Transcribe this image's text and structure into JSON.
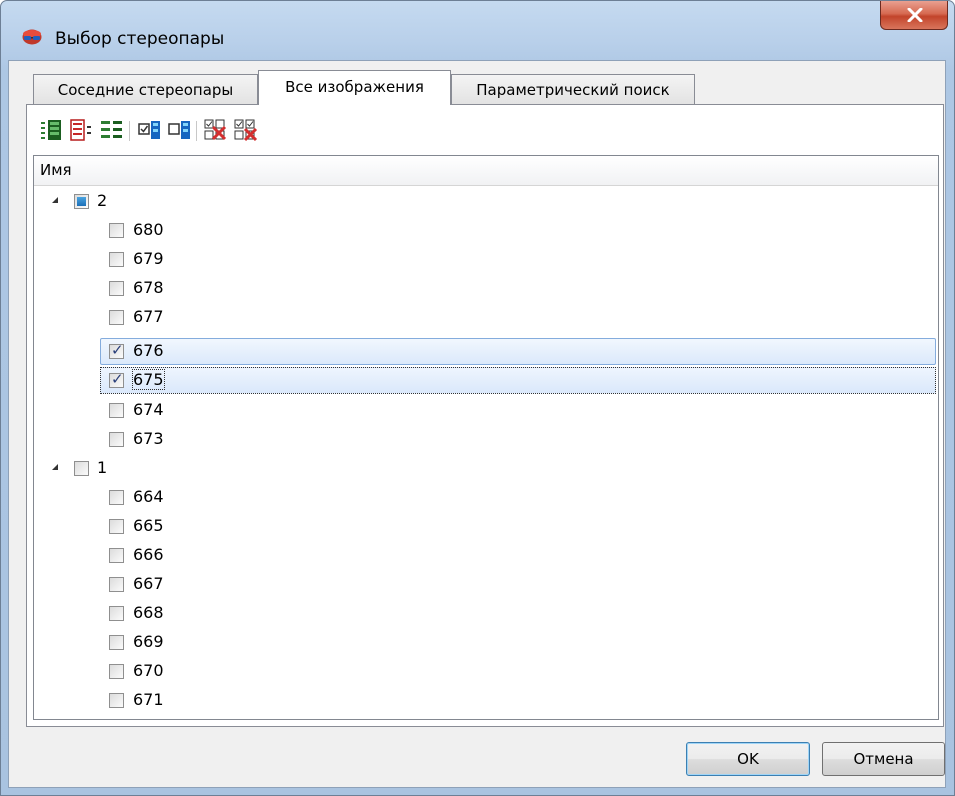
{
  "window": {
    "title": "Выбор стереопары",
    "app_icon": "stereo-glasses-icon",
    "close_icon": "close-icon"
  },
  "tabs": [
    {
      "label": "Соседние стереопары",
      "active": false
    },
    {
      "label": "Все изображения",
      "active": true
    },
    {
      "label": "Параметрический поиск",
      "active": false
    }
  ],
  "toolbar": [
    {
      "icon": "expand-all-icon"
    },
    {
      "icon": "collapse-all-icon"
    },
    {
      "icon": "expand-selected-icon"
    },
    {
      "icon": "check-all-icon"
    },
    {
      "icon": "uncheck-all-icon"
    },
    {
      "icon": "remove-checked-icon"
    },
    {
      "icon": "remove-all-icon"
    }
  ],
  "tree": {
    "column_header": "Имя",
    "groups": [
      {
        "label": "2",
        "state": "partial",
        "items": [
          {
            "label": "680",
            "checked": false
          },
          {
            "label": "679",
            "checked": false
          },
          {
            "label": "678",
            "checked": false
          },
          {
            "label": "677",
            "checked": false
          },
          {
            "label": "676",
            "checked": true
          },
          {
            "label": "675",
            "checked": true
          },
          {
            "label": "674",
            "checked": false
          },
          {
            "label": "673",
            "checked": false
          }
        ]
      },
      {
        "label": "1",
        "state": "unchecked",
        "items": [
          {
            "label": "664",
            "checked": false
          },
          {
            "label": "665",
            "checked": false
          },
          {
            "label": "666",
            "checked": false
          },
          {
            "label": "667",
            "checked": false
          },
          {
            "label": "668",
            "checked": false
          },
          {
            "label": "669",
            "checked": false
          },
          {
            "label": "670",
            "checked": false
          },
          {
            "label": "671",
            "checked": false
          }
        ]
      }
    ]
  },
  "buttons": {
    "ok": "OK",
    "cancel": "Отмена"
  }
}
